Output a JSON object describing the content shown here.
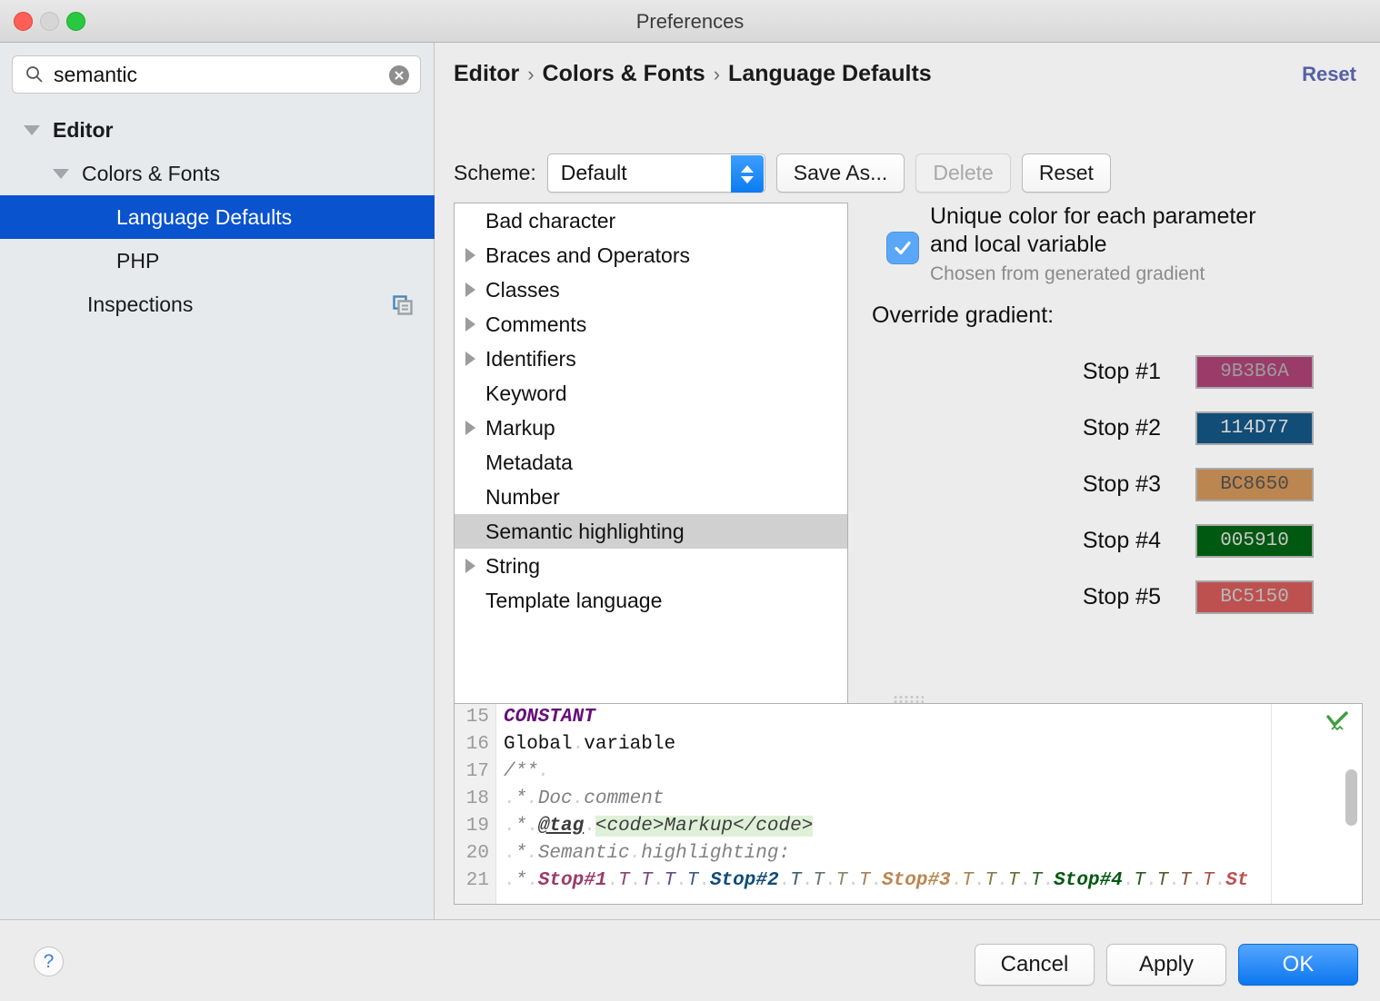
{
  "window": {
    "title": "Preferences"
  },
  "sidebar": {
    "search": {
      "value": "semantic",
      "placeholder": "Search",
      "icon": "search-icon",
      "clear_icon": "clear-icon"
    },
    "tree": [
      {
        "label": "Editor",
        "indent": 0,
        "twisty": "down",
        "bold": true,
        "selected": false
      },
      {
        "label": "Colors & Fonts",
        "indent": 1,
        "twisty": "down",
        "bold": false,
        "selected": false
      },
      {
        "label": "Language Defaults",
        "indent": 2,
        "twisty": "none",
        "bold": false,
        "selected": true
      },
      {
        "label": "PHP",
        "indent": 2,
        "twisty": "none",
        "bold": false,
        "selected": false
      },
      {
        "label": "Inspections",
        "indent": 1,
        "twisty": "none",
        "bold": false,
        "selected": false,
        "badge_icon": "copy-icon"
      }
    ]
  },
  "header": {
    "breadcrumb": [
      "Editor",
      "Colors & Fonts",
      "Language Defaults"
    ],
    "separator": "›",
    "reset_link": "Reset",
    "reset_link_color": "#5561a5"
  },
  "scheme_bar": {
    "label": "Scheme:",
    "selected": "Default",
    "options": [
      "Default"
    ],
    "save_as": "Save As...",
    "delete": "Delete",
    "delete_enabled": false,
    "reset": "Reset"
  },
  "attributes": {
    "items": [
      {
        "label": "Bad character",
        "expandable": false,
        "selected": false
      },
      {
        "label": "Braces and Operators",
        "expandable": true,
        "selected": false
      },
      {
        "label": "Classes",
        "expandable": true,
        "selected": false
      },
      {
        "label": "Comments",
        "expandable": true,
        "selected": false
      },
      {
        "label": "Identifiers",
        "expandable": true,
        "selected": false
      },
      {
        "label": "Keyword",
        "expandable": false,
        "selected": false
      },
      {
        "label": "Markup",
        "expandable": true,
        "selected": false
      },
      {
        "label": "Metadata",
        "expandable": false,
        "selected": false
      },
      {
        "label": "Number",
        "expandable": false,
        "selected": false
      },
      {
        "label": "Semantic highlighting",
        "expandable": false,
        "selected": true
      },
      {
        "label": "String",
        "expandable": true,
        "selected": false
      },
      {
        "label": "Template language",
        "expandable": false,
        "selected": false
      }
    ]
  },
  "options": {
    "unique_color_checkbox": {
      "label_line1": "Unique color for each parameter",
      "label_line2": "and local variable",
      "sub_label": "Chosen from generated gradient",
      "checked": true
    },
    "override_gradient_title": "Override gradient:",
    "stops": [
      {
        "label": "Stop #1",
        "hex": "9B3B6A",
        "swatch_color": "#9B3B6A",
        "text_color": "#9d9d9d"
      },
      {
        "label": "Stop #2",
        "hex": "114D77",
        "swatch_color": "#114D77",
        "text_color": "#d6d6d6"
      },
      {
        "label": "Stop #3",
        "hex": "BC8650",
        "swatch_color": "#BC8650",
        "text_color": "#4a4a4a"
      },
      {
        "label": "Stop #4",
        "hex": "005910",
        "swatch_color": "#005910",
        "text_color": "#c9c9c9"
      },
      {
        "label": "Stop #5",
        "hex": "BC5150",
        "swatch_color": "#BC5150",
        "text_color": "#b8b8b8"
      }
    ]
  },
  "preview": {
    "inspection_icon": "green-check-icon",
    "lines": [
      {
        "number": "15",
        "text": "CONSTANT"
      },
      {
        "number": "16",
        "text": "Global variable"
      },
      {
        "number": "17",
        "text": "/**"
      },
      {
        "number": "18",
        "text": " * Doc comment"
      },
      {
        "number": "19",
        "text": " * @tag <code>Markup</code>"
      },
      {
        "number": "20",
        "text": " * Semantic highlighting:"
      },
      {
        "number": "21",
        "text": " * Stop#1 T T T T Stop#2 T T T T Stop#3 T T T T Stop#4 T T T T St"
      }
    ],
    "gradient_line": {
      "prefix": " * ",
      "segments": [
        {
          "text": "Stop#1",
          "color": "#9B3B6A",
          "kind": "stop"
        },
        {
          "text": "T",
          "color": "#8A4173",
          "kind": "t"
        },
        {
          "text": "T",
          "color": "#79477C",
          "kind": "t"
        },
        {
          "text": "T",
          "color": "#674B83",
          "kind": "t"
        },
        {
          "text": "T",
          "color": "#3F5A87",
          "kind": "t"
        },
        {
          "text": "Stop#2",
          "color": "#114D77",
          "kind": "stop"
        },
        {
          "text": "T",
          "color": "#3A6073",
          "kind": "t"
        },
        {
          "text": "T",
          "color": "#63746E",
          "kind": "t"
        },
        {
          "text": "T",
          "color": "#8B8868",
          "kind": "t"
        },
        {
          "text": "T",
          "color": "#A97F5C",
          "kind": "t"
        },
        {
          "text": "Stop#3",
          "color": "#BC8650",
          "kind": "stop"
        },
        {
          "text": "T",
          "color": "#A98350",
          "kind": "t"
        },
        {
          "text": "T",
          "color": "#8A7C45",
          "kind": "t"
        },
        {
          "text": "T",
          "color": "#5F7234",
          "kind": "t"
        },
        {
          "text": "T",
          "color": "#2F6421",
          "kind": "t"
        },
        {
          "text": "Stop#4",
          "color": "#005910",
          "kind": "stop"
        },
        {
          "text": "T",
          "color": "#2A5A1D",
          "kind": "t"
        },
        {
          "text": "T",
          "color": "#545C2E",
          "kind": "t"
        },
        {
          "text": "T",
          "color": "#7D563C",
          "kind": "t"
        },
        {
          "text": "T",
          "color": "#A55248",
          "kind": "t"
        },
        {
          "text": "St",
          "color": "#BC5150",
          "kind": "stop"
        }
      ]
    }
  },
  "footer": {
    "help": "?",
    "cancel": "Cancel",
    "apply": "Apply",
    "ok": "OK"
  }
}
